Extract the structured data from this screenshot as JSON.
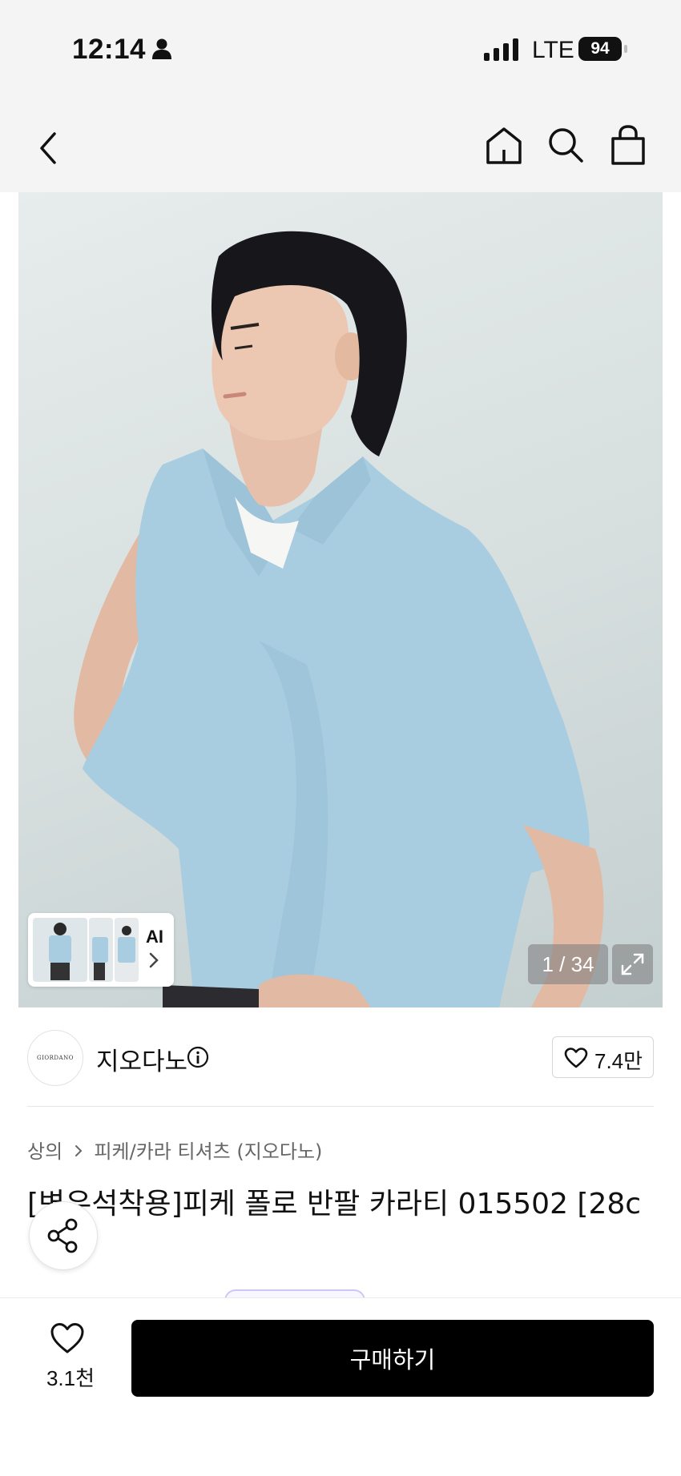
{
  "status_bar": {
    "time": "12:14",
    "network": "LTE",
    "battery": "94"
  },
  "nav": {
    "icons": [
      "back-icon",
      "home-icon",
      "search-icon",
      "shopping-bag-icon"
    ]
  },
  "gallery": {
    "ai_label": "AI",
    "counter": "1 / 34",
    "colors": {
      "shirt": "#a9cde0",
      "background": "#dde3e3"
    }
  },
  "brand": {
    "logo_text": "GIORDANO",
    "name": "지오다노",
    "likes": "7.4만"
  },
  "breadcrumb": {
    "category": "상의",
    "subcategory": "피케/카라 티셔츠 (지오다노)"
  },
  "product": {
    "title": "[변우석착용]피케 폴로 반팔 카라티 015502 [28c"
  },
  "bottom_bar": {
    "wish_count": "3.1천",
    "buy_label": "구매하기"
  }
}
